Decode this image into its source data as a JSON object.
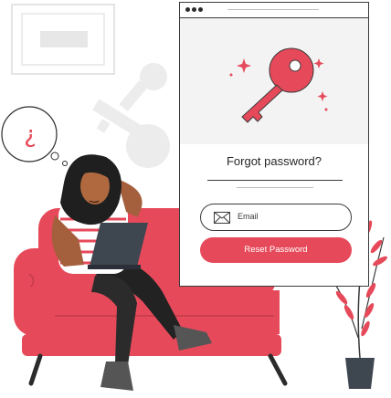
{
  "dialog": {
    "title": "Forgot password?",
    "email_placeholder": "Email",
    "reset_button_label": "Reset Password"
  },
  "thought_bubble": {
    "symbol": "¿"
  },
  "icons": [
    "key-icon",
    "sparkle-icon",
    "envelope-icon",
    "question-mark-icon",
    "window-dots-icon"
  ],
  "colors": {
    "accent": "#e64a5a",
    "sofa": "#e64a5a",
    "outline": "#3a3a3a",
    "panel": "#f3f3f3",
    "ghost": "#ececec"
  }
}
